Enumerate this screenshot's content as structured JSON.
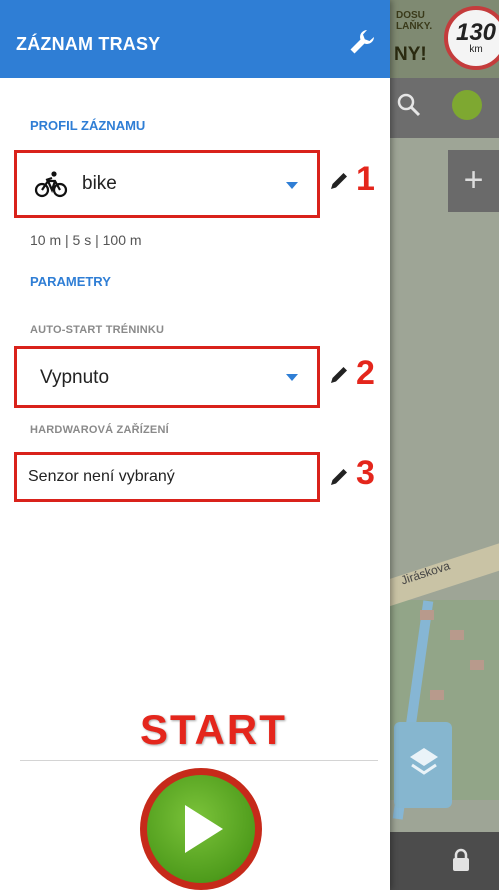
{
  "map": {
    "ad_text_lines": [
      "DOSU",
      "LAŇKY.",
      "NY!"
    ],
    "speed_sign_value": "130",
    "speed_sign_unit": "km",
    "street_label": "Jiráskova"
  },
  "header": {
    "title": "ZÁZNAM TRASY",
    "settings_icon": "wrench-icon"
  },
  "profile": {
    "section_title": "PROFIL ZÁZNAMU",
    "selected": "bike",
    "icon": "bicycle-icon",
    "params": "10 m | 5 s | 100 m",
    "annotation": "1"
  },
  "parameters": {
    "section_title": "PARAMETRY",
    "autostart_label": "AUTO-START TRÉNINKU",
    "autostart_value": "Vypnuto",
    "autostart_annotation": "2",
    "hardware_label": "HARDWAROVÁ ZAŘÍZENÍ",
    "hardware_value": "Senzor není vybraný",
    "hardware_annotation": "3"
  },
  "start": {
    "label": "START",
    "button_icon": "play-icon"
  },
  "colors": {
    "header": "#2f7ed5",
    "accent": "#2f7ed5",
    "annotation": "#e4261c",
    "play_button": "#4f9c1c"
  }
}
